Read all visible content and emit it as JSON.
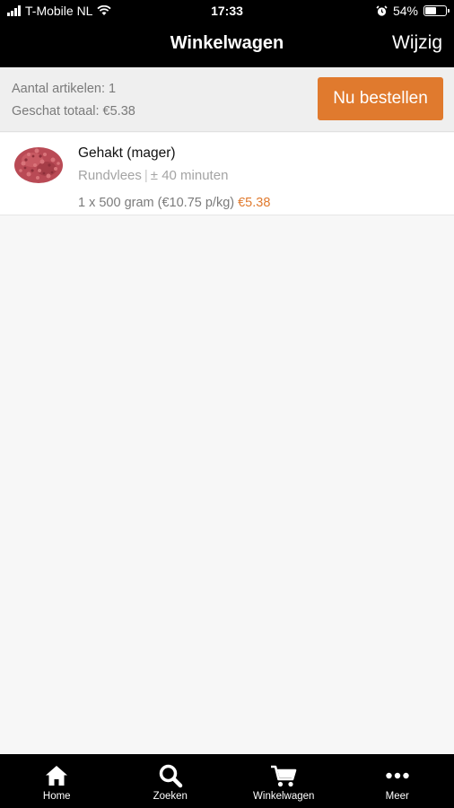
{
  "status_bar": {
    "carrier": "T-Mobile NL",
    "time": "17:33",
    "battery_percent": "54%",
    "battery_level": 0.54,
    "icons": [
      "signal-icon",
      "wifi-icon",
      "alarm-icon",
      "battery-icon"
    ]
  },
  "nav": {
    "title": "Winkelwagen",
    "edit_label": "Wijzig"
  },
  "summary": {
    "item_count_text": "Aantal artikelen: 1",
    "total_text": "Geschat totaal: €5.38",
    "order_button_label": "Nu bestellen"
  },
  "cart": {
    "items": [
      {
        "name": "Gehakt (mager)",
        "category": "Rundvlees",
        "separator": "|",
        "prep_time": "± 40 minuten",
        "quantity_text": "1 x 500 gram (€10.75 p/kg)",
        "price": "€5.38",
        "image_icon": "minced-meat-image"
      }
    ]
  },
  "tabbar": {
    "tabs": [
      {
        "label": "Home",
        "icon": "home-icon"
      },
      {
        "label": "Zoeken",
        "icon": "search-icon"
      },
      {
        "label": "Winkelwagen",
        "icon": "cart-icon"
      },
      {
        "label": "Meer",
        "icon": "more-icon"
      }
    ]
  },
  "colors": {
    "accent": "#e07a2e",
    "bar_background": "#000000",
    "summary_background": "#efefef",
    "page_background": "#f7f7f7"
  }
}
